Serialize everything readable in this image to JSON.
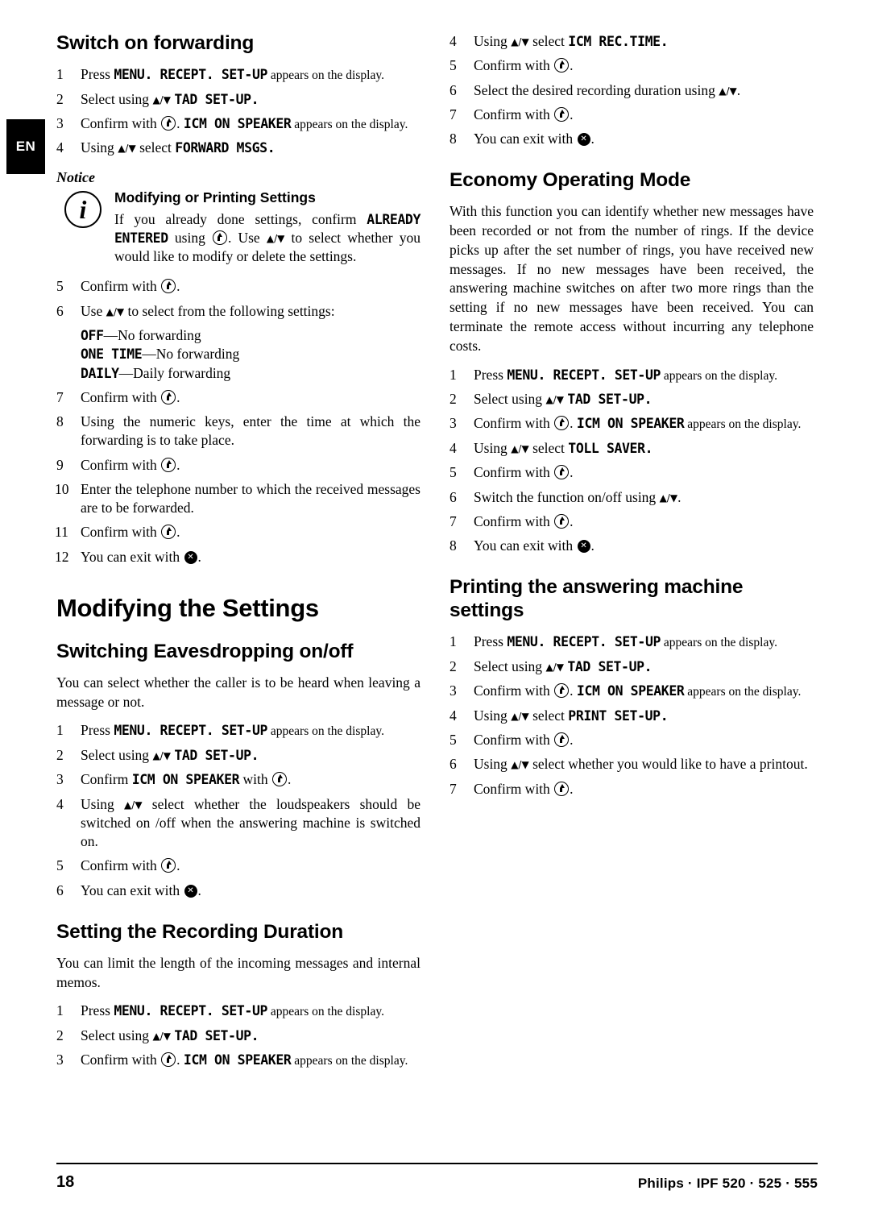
{
  "side_tab": "EN",
  "footer": {
    "page_number": "18",
    "brand": "Philips · IPF 520 · 525 · 555"
  },
  "left_column": {
    "switch_on_forwarding": {
      "heading": "Switch on forwarding",
      "steps": [
        {
          "num": "1",
          "parts": [
            {
              "t": "Press ",
              "s": "normal"
            },
            {
              "t": "MENU",
              "s": "mono"
            },
            {
              "t": ". ",
              "s": "mono"
            },
            {
              "t": "RECEPT. SET-UP",
              "s": "mono"
            },
            {
              "t": " appears on the display.",
              "s": "small"
            }
          ]
        },
        {
          "num": "2",
          "parts": [
            {
              "t": "Select using ",
              "s": "normal"
            },
            {
              "t": "updown",
              "s": "icon"
            },
            {
              "t": " ",
              "s": "normal"
            },
            {
              "t": "TAD SET-UP",
              "s": "mono"
            },
            {
              "t": ".",
              "s": "mono"
            }
          ]
        },
        {
          "num": "3",
          "parts": [
            {
              "t": "Confirm with ",
              "s": "normal"
            },
            {
              "t": "ok",
              "s": "icon"
            },
            {
              "t": ". ",
              "s": "normal"
            },
            {
              "t": "ICM ON SPEAKER",
              "s": "mono"
            },
            {
              "t": " appears on the display.",
              "s": "small"
            }
          ]
        },
        {
          "num": "4",
          "parts": [
            {
              "t": "Using ",
              "s": "normal"
            },
            {
              "t": "updown",
              "s": "icon"
            },
            {
              "t": " select ",
              "s": "normal"
            },
            {
              "t": "FORWARD MSGS",
              "s": "mono"
            },
            {
              "t": ".",
              "s": "mono"
            }
          ]
        }
      ],
      "notice": {
        "label": "Notice",
        "title": "Modifying or Printing Settings",
        "text_before": "If you already done settings, confirm ",
        "keyword": "ALREADY ENTERED",
        "text_mid": " using ",
        "text_after": ". Use ",
        "text_end": " to select whether you would like to modify or delete the settings."
      },
      "steps2": [
        {
          "num": "5",
          "parts": [
            {
              "t": "Confirm with ",
              "s": "normal"
            },
            {
              "t": "ok",
              "s": "icon"
            },
            {
              "t": ".",
              "s": "normal"
            }
          ]
        },
        {
          "num": "6",
          "parts": [
            {
              "t": "Use ",
              "s": "normal"
            },
            {
              "t": "updown",
              "s": "icon"
            },
            {
              "t": " to select from the following settings:",
              "s": "normal"
            }
          ]
        }
      ],
      "settings_list": [
        {
          "key": "OFF",
          "desc": "—No forwarding"
        },
        {
          "key": "ONE TIME",
          "desc": "—No forwarding"
        },
        {
          "key": "DAILY",
          "desc": "—Daily forwarding"
        }
      ],
      "steps3": [
        {
          "num": "7",
          "parts": [
            {
              "t": "Confirm with ",
              "s": "normal"
            },
            {
              "t": "ok",
              "s": "icon"
            },
            {
              "t": ".",
              "s": "normal"
            }
          ]
        },
        {
          "num": "8",
          "parts": [
            {
              "t": "Using the numeric keys, enter the time at which the forwarding is to take place.",
              "s": "normal"
            }
          ]
        },
        {
          "num": "9",
          "parts": [
            {
              "t": "Confirm with ",
              "s": "normal"
            },
            {
              "t": "ok",
              "s": "icon"
            },
            {
              "t": ".",
              "s": "normal"
            }
          ]
        },
        {
          "num": "10",
          "parts": [
            {
              "t": "Enter the telephone number to which the received messages are to be forwarded.",
              "s": "normal"
            }
          ]
        },
        {
          "num": "11",
          "parts": [
            {
              "t": "Confirm with ",
              "s": "normal"
            },
            {
              "t": "ok",
              "s": "icon"
            },
            {
              "t": ".",
              "s": "normal"
            }
          ]
        },
        {
          "num": "12",
          "parts": [
            {
              "t": "You can exit with ",
              "s": "normal"
            },
            {
              "t": "stop",
              "s": "icon"
            },
            {
              "t": ".",
              "s": "normal"
            }
          ]
        }
      ]
    },
    "modifying_settings": {
      "heading": "Modifying the Settings"
    },
    "switching_eavesdropping": {
      "heading": "Switching Eavesdropping on/off",
      "intro": "You can select whether the caller is to be heard when leaving a message or not.",
      "steps": [
        {
          "num": "1",
          "parts": [
            {
              "t": "Press ",
              "s": "normal"
            },
            {
              "t": "MENU",
              "s": "mono"
            },
            {
              "t": ". ",
              "s": "mono"
            },
            {
              "t": "RECEPT. SET-UP",
              "s": "mono"
            },
            {
              "t": " appears on the display.",
              "s": "small"
            }
          ]
        },
        {
          "num": "2",
          "parts": [
            {
              "t": "Select using ",
              "s": "normal"
            },
            {
              "t": "updown",
              "s": "icon"
            },
            {
              "t": " ",
              "s": "normal"
            },
            {
              "t": "TAD SET-UP",
              "s": "mono"
            },
            {
              "t": ".",
              "s": "mono"
            }
          ]
        },
        {
          "num": "3",
          "parts": [
            {
              "t": "Confirm ",
              "s": "normal"
            },
            {
              "t": "ICM ON SPEAKER",
              "s": "mono"
            },
            {
              "t": " with ",
              "s": "normal"
            },
            {
              "t": "ok",
              "s": "icon"
            },
            {
              "t": ".",
              "s": "normal"
            }
          ]
        },
        {
          "num": "4",
          "parts": [
            {
              "t": "Using ",
              "s": "normal"
            },
            {
              "t": "updown",
              "s": "icon"
            },
            {
              "t": " select whether the loudspeakers should be switched on /off when the answering machine is switched on.",
              "s": "normal"
            }
          ]
        },
        {
          "num": "5",
          "parts": [
            {
              "t": "Confirm with ",
              "s": "normal"
            },
            {
              "t": "ok",
              "s": "icon"
            },
            {
              "t": ".",
              "s": "normal"
            }
          ]
        },
        {
          "num": "6",
          "parts": [
            {
              "t": "You can exit with ",
              "s": "normal"
            },
            {
              "t": "stop",
              "s": "icon"
            },
            {
              "t": ".",
              "s": "normal"
            }
          ]
        }
      ]
    },
    "recording_duration": {
      "heading": "Setting the Recording Duration",
      "intro": "You can limit the length of the incoming messages and internal memos.",
      "steps": [
        {
          "num": "1",
          "parts": [
            {
              "t": "Press ",
              "s": "normal"
            },
            {
              "t": "MENU",
              "s": "mono"
            },
            {
              "t": ". ",
              "s": "mono"
            },
            {
              "t": "RECEPT. SET-UP",
              "s": "mono"
            },
            {
              "t": " appears on the display.",
              "s": "small"
            }
          ]
        },
        {
          "num": "2",
          "parts": [
            {
              "t": "Select using ",
              "s": "normal"
            },
            {
              "t": "updown",
              "s": "icon"
            },
            {
              "t": " ",
              "s": "normal"
            },
            {
              "t": "TAD SET-UP",
              "s": "mono"
            },
            {
              "t": ".",
              "s": "mono"
            }
          ]
        },
        {
          "num": "3",
          "parts": [
            {
              "t": "Confirm with ",
              "s": "normal"
            },
            {
              "t": "ok",
              "s": "icon"
            },
            {
              "t": ". ",
              "s": "normal"
            },
            {
              "t": "ICM ON SPEAKER",
              "s": "mono"
            },
            {
              "t": " appears on the display.",
              "s": "small"
            }
          ]
        }
      ]
    }
  },
  "right_column": {
    "recording_duration_cont": {
      "steps": [
        {
          "num": "4",
          "parts": [
            {
              "t": "Using ",
              "s": "normal"
            },
            {
              "t": "updown",
              "s": "icon"
            },
            {
              "t": " select ",
              "s": "normal"
            },
            {
              "t": "ICM REC.TIME",
              "s": "mono"
            },
            {
              "t": ".",
              "s": "mono"
            }
          ]
        },
        {
          "num": "5",
          "parts": [
            {
              "t": "Confirm with ",
              "s": "normal"
            },
            {
              "t": "ok",
              "s": "icon"
            },
            {
              "t": ".",
              "s": "normal"
            }
          ]
        },
        {
          "num": "6",
          "parts": [
            {
              "t": "Select the desired recording duration using ",
              "s": "normal"
            },
            {
              "t": "updown",
              "s": "icon"
            },
            {
              "t": ".",
              "s": "normal"
            }
          ]
        },
        {
          "num": "7",
          "parts": [
            {
              "t": "Confirm with ",
              "s": "normal"
            },
            {
              "t": "ok",
              "s": "icon"
            },
            {
              "t": ".",
              "s": "normal"
            }
          ]
        },
        {
          "num": "8",
          "parts": [
            {
              "t": "You can exit with ",
              "s": "normal"
            },
            {
              "t": "stop",
              "s": "icon"
            },
            {
              "t": ".",
              "s": "normal"
            }
          ]
        }
      ]
    },
    "economy_mode": {
      "heading": "Economy Operating Mode",
      "intro": "With this function you can identify whether new messages have been recorded or not from the number of rings. If the device picks up after the set number of rings, you have received new messages. If no new messages have been received, the answering machine switches on after two more rings than the setting if no new messages have been received. You can terminate the remote access without incurring any telephone costs.",
      "steps": [
        {
          "num": "1",
          "parts": [
            {
              "t": "Press ",
              "s": "normal"
            },
            {
              "t": "MENU",
              "s": "mono"
            },
            {
              "t": ". ",
              "s": "mono"
            },
            {
              "t": "RECEPT. SET-UP",
              "s": "mono"
            },
            {
              "t": " appears on the display.",
              "s": "small"
            }
          ]
        },
        {
          "num": "2",
          "parts": [
            {
              "t": "Select using ",
              "s": "normal"
            },
            {
              "t": "updown",
              "s": "icon"
            },
            {
              "t": " ",
              "s": "normal"
            },
            {
              "t": "TAD SET-UP",
              "s": "mono"
            },
            {
              "t": ".",
              "s": "mono"
            }
          ]
        },
        {
          "num": "3",
          "parts": [
            {
              "t": "Confirm with ",
              "s": "normal"
            },
            {
              "t": "ok",
              "s": "icon"
            },
            {
              "t": ". ",
              "s": "normal"
            },
            {
              "t": "ICM ON SPEAKER",
              "s": "mono"
            },
            {
              "t": " appears on the display.",
              "s": "small"
            }
          ]
        },
        {
          "num": "4",
          "parts": [
            {
              "t": "Using ",
              "s": "normal"
            },
            {
              "t": "updown",
              "s": "icon"
            },
            {
              "t": " select ",
              "s": "normal"
            },
            {
              "t": "TOLL SAVER",
              "s": "mono"
            },
            {
              "t": ".",
              "s": "mono"
            }
          ]
        },
        {
          "num": "5",
          "parts": [
            {
              "t": "Confirm with ",
              "s": "normal"
            },
            {
              "t": "ok",
              "s": "icon"
            },
            {
              "t": ".",
              "s": "normal"
            }
          ]
        },
        {
          "num": "6",
          "parts": [
            {
              "t": "Switch the function on/off using ",
              "s": "normal"
            },
            {
              "t": "updown",
              "s": "icon"
            },
            {
              "t": ".",
              "s": "normal"
            }
          ]
        },
        {
          "num": "7",
          "parts": [
            {
              "t": "Confirm with ",
              "s": "normal"
            },
            {
              "t": "ok",
              "s": "icon"
            },
            {
              "t": ".",
              "s": "normal"
            }
          ]
        },
        {
          "num": "8",
          "parts": [
            {
              "t": "You can exit with ",
              "s": "normal"
            },
            {
              "t": "stop",
              "s": "icon"
            },
            {
              "t": ".",
              "s": "normal"
            }
          ]
        }
      ]
    },
    "printing_settings": {
      "heading": "Printing the answering machine settings",
      "steps": [
        {
          "num": "1",
          "parts": [
            {
              "t": "Press ",
              "s": "normal"
            },
            {
              "t": "MENU",
              "s": "mono"
            },
            {
              "t": ". ",
              "s": "mono"
            },
            {
              "t": "RECEPT. SET-UP",
              "s": "mono"
            },
            {
              "t": " appears on the display.",
              "s": "small"
            }
          ]
        },
        {
          "num": "2",
          "parts": [
            {
              "t": "Select using ",
              "s": "normal"
            },
            {
              "t": "updown",
              "s": "icon"
            },
            {
              "t": " ",
              "s": "normal"
            },
            {
              "t": "TAD SET-UP",
              "s": "mono"
            },
            {
              "t": ".",
              "s": "mono"
            }
          ]
        },
        {
          "num": "3",
          "parts": [
            {
              "t": "Confirm with ",
              "s": "normal"
            },
            {
              "t": "ok",
              "s": "icon"
            },
            {
              "t": ". ",
              "s": "normal"
            },
            {
              "t": "ICM ON SPEAKER",
              "s": "mono"
            },
            {
              "t": " appears on the display.",
              "s": "small"
            }
          ]
        },
        {
          "num": "4",
          "parts": [
            {
              "t": "Using ",
              "s": "normal"
            },
            {
              "t": "updown",
              "s": "icon"
            },
            {
              "t": " select ",
              "s": "normal"
            },
            {
              "t": "PRINT SET-UP",
              "s": "mono"
            },
            {
              "t": ".",
              "s": "mono"
            }
          ]
        },
        {
          "num": "5",
          "parts": [
            {
              "t": "Confirm with ",
              "s": "normal"
            },
            {
              "t": "ok",
              "s": "icon"
            },
            {
              "t": ".",
              "s": "normal"
            }
          ]
        },
        {
          "num": "6",
          "parts": [
            {
              "t": "Using ",
              "s": "normal"
            },
            {
              "t": "updown",
              "s": "icon"
            },
            {
              "t": " select whether you would like to have a printout.",
              "s": "normal"
            }
          ]
        },
        {
          "num": "7",
          "parts": [
            {
              "t": "Confirm with ",
              "s": "normal"
            },
            {
              "t": "ok",
              "s": "icon"
            },
            {
              "t": ".",
              "s": "normal"
            }
          ]
        }
      ]
    }
  }
}
